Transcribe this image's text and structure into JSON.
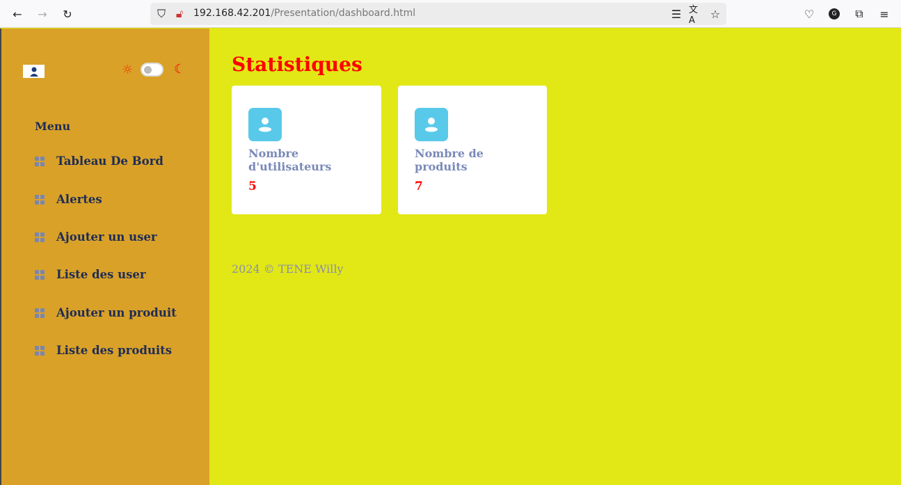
{
  "browser": {
    "url_host": "192.168.42.201",
    "url_path": "/Presentation/dashboard.html"
  },
  "sidebar": {
    "menu_title": "Menu",
    "items": [
      {
        "label": "Tableau De Bord"
      },
      {
        "label": "Alertes"
      },
      {
        "label": "Ajouter un user"
      },
      {
        "label": "Liste des user"
      },
      {
        "label": "Ajouter un produit"
      },
      {
        "label": "Liste des produits"
      }
    ]
  },
  "main": {
    "title": "Statistiques",
    "cards": [
      {
        "label": "Nombre d'utilisateurs",
        "value": "5"
      },
      {
        "label": "Nombre de produits",
        "value": "7"
      }
    ]
  },
  "footer": {
    "text": "2024 © TENE Willy"
  }
}
